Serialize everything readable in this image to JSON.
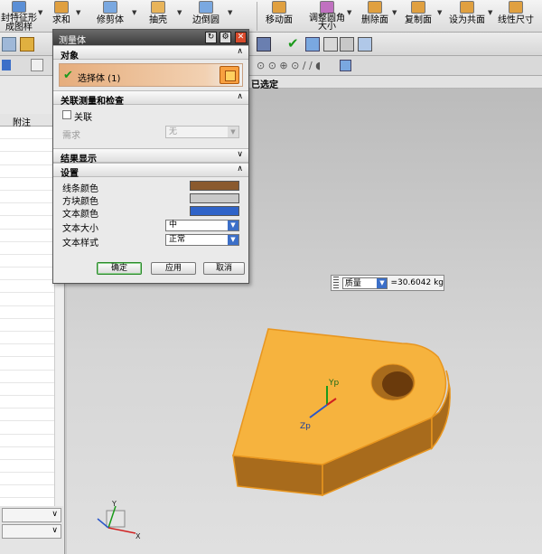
{
  "toolbar": {
    "items": [
      {
        "label": "封特征形\n成图样"
      },
      {
        "label": "求和"
      },
      {
        "label": "修剪体"
      },
      {
        "label": "抽壳"
      },
      {
        "label": "边倒圆"
      },
      {
        "label": "移动面"
      },
      {
        "label": "调整圆角\n大小"
      },
      {
        "label": "删除面"
      },
      {
        "label": "复制面"
      },
      {
        "label": "设为共面"
      },
      {
        "label": "线性尺寸"
      }
    ]
  },
  "left_panel": {
    "column_header": "附注"
  },
  "viewport": {
    "selection_label": "已选定",
    "axes": {
      "y": "Yp",
      "z": "Zp"
    },
    "triad": {
      "y": "Y",
      "x": "X"
    }
  },
  "measure_readout": {
    "property": "质量",
    "value": "=30.6042 kg"
  },
  "dialog": {
    "title": "测量体",
    "sections": {
      "object": "对象",
      "related": "关联测量和检查",
      "results": "结果显示",
      "settings": "设置"
    },
    "select_body": "选择体 (1)",
    "associative": "关联",
    "requirement_label": "需求",
    "requirement_value": "无",
    "settings": {
      "line_color_label": "线条颜色",
      "block_color_label": "方块颜色",
      "text_color_label": "文本颜色",
      "text_size_label": "文本大小",
      "text_size_value": "中",
      "text_style_label": "文本样式",
      "text_style_value": "正常",
      "line_color": "#8a5a2e",
      "block_color": "#c9c9c9",
      "text_color": "#2f63c8"
    },
    "buttons": {
      "ok": "确定",
      "apply": "应用",
      "cancel": "取消"
    }
  },
  "colors": {
    "part_face": "#f6b33e",
    "part_edge": "#e8961f",
    "part_shadow": "#a86b1c"
  }
}
